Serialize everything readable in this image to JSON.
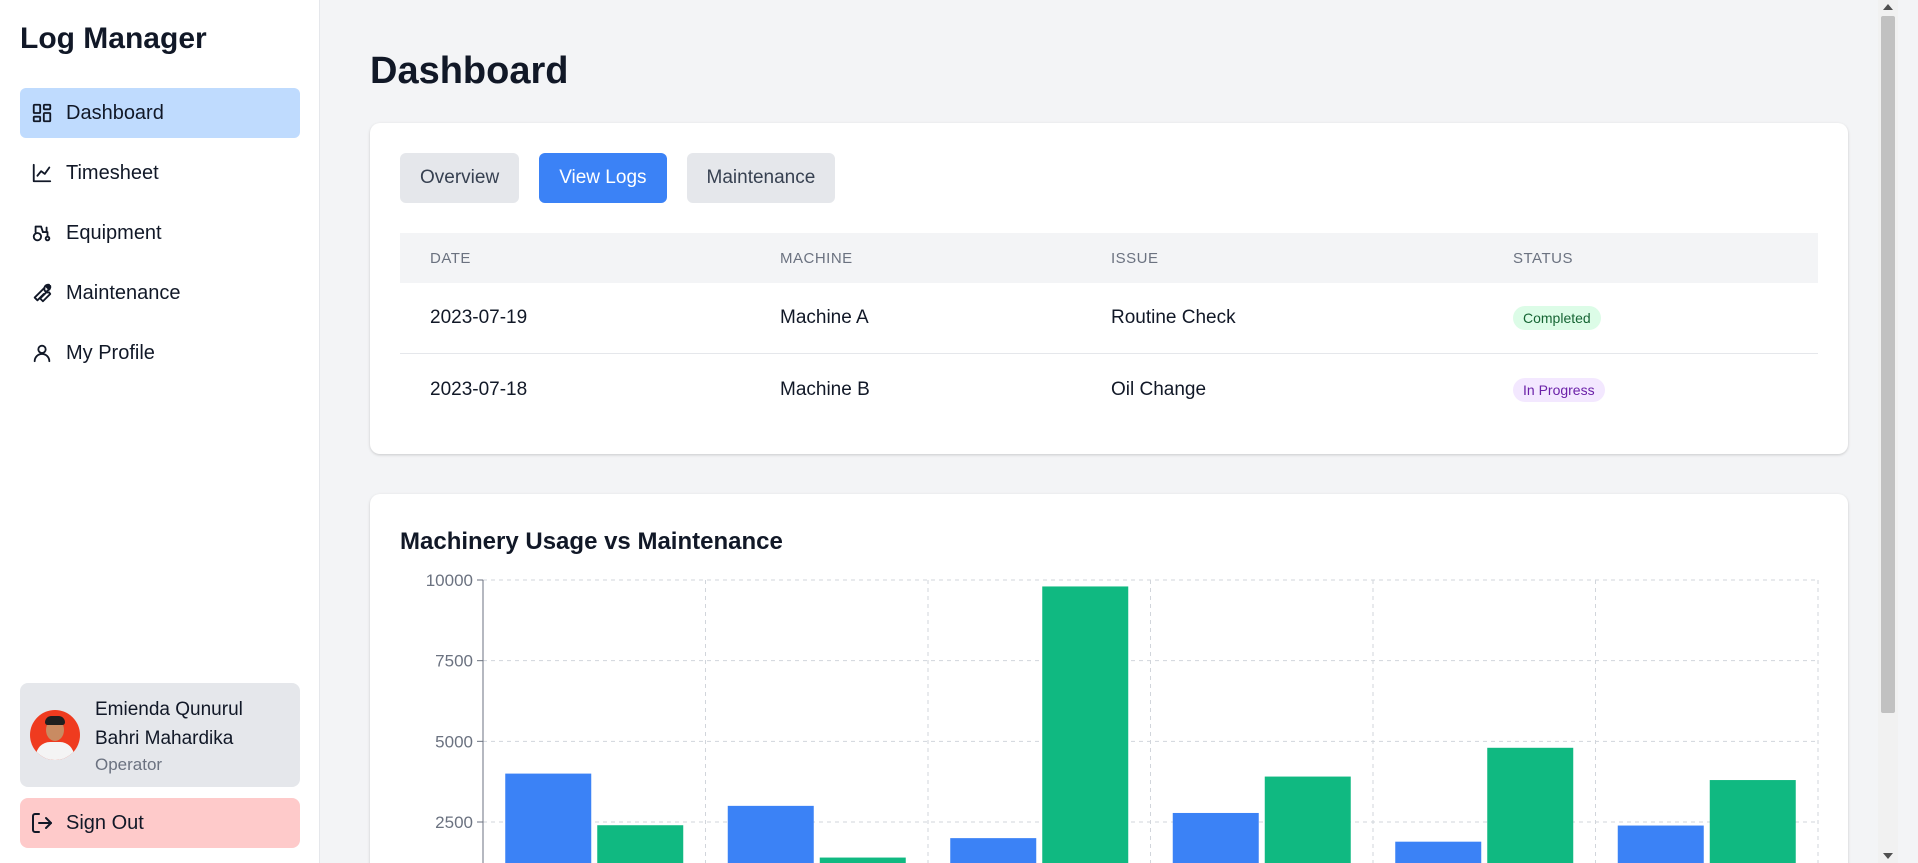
{
  "sidebar": {
    "brand": "Log Manager",
    "items": [
      {
        "label": "Dashboard",
        "icon": "dashboard-icon",
        "active": true
      },
      {
        "label": "Timesheet",
        "icon": "chart-line-icon",
        "active": false
      },
      {
        "label": "Equipment",
        "icon": "tractor-icon",
        "active": false
      },
      {
        "label": "Maintenance",
        "icon": "wrench-icon",
        "active": false
      },
      {
        "label": "My Profile",
        "icon": "user-icon",
        "active": false
      }
    ],
    "user": {
      "name": "Emienda Qunurul Bahri Mahardika",
      "role": "Operator"
    },
    "signout_label": "Sign Out"
  },
  "main": {
    "title": "Dashboard",
    "tabs": [
      {
        "label": "Overview",
        "active": false
      },
      {
        "label": "View Logs",
        "active": true
      },
      {
        "label": "Maintenance",
        "active": false
      }
    ],
    "table": {
      "headers": [
        "DATE",
        "MACHINE",
        "ISSUE",
        "STATUS"
      ],
      "rows": [
        {
          "date": "2023-07-19",
          "machine": "Machine A",
          "issue": "Routine Check",
          "status": "Completed"
        },
        {
          "date": "2023-07-18",
          "machine": "Machine B",
          "issue": "Oil Change",
          "status": "In Progress"
        }
      ]
    }
  },
  "colors": {
    "accent": "#3b82f6",
    "active_nav": "#bfdbfe",
    "signout_bg": "#fecaca",
    "series_usage": "#3b82f6",
    "series_maintenance": "#10b981"
  },
  "chart_data": {
    "type": "bar",
    "title": "Machinery Usage vs Maintenance",
    "xlabel": "",
    "ylabel": "",
    "ylim": [
      0,
      10000
    ],
    "yticks": [
      "10000",
      "7500",
      "5000",
      "2500"
    ],
    "grid": true,
    "categories": [
      "",
      "",
      "",
      "",
      "",
      ""
    ],
    "series": [
      {
        "values": [
          4000,
          3000,
          2000,
          2780,
          1890,
          2390
        ],
        "color": "#3b82f6"
      },
      {
        "values": [
          2400,
          1398,
          9800,
          3908,
          4800,
          3800
        ],
        "color": "#10b981"
      }
    ]
  }
}
